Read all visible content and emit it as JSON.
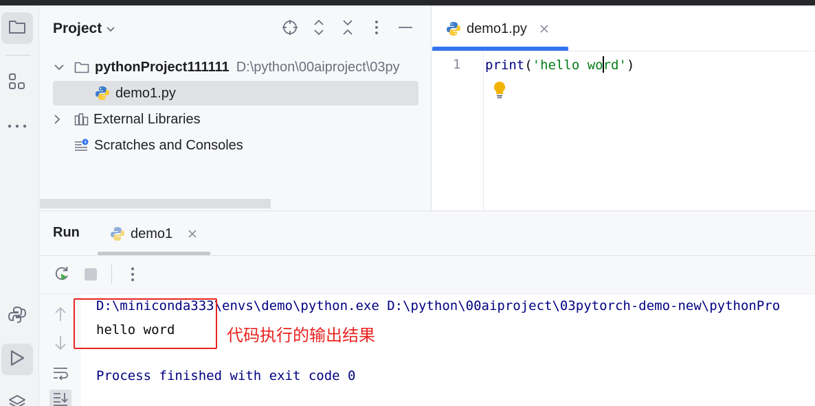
{
  "project_panel": {
    "title": "Project",
    "tree": [
      {
        "label": "pythonProject111111",
        "path": "D:\\python\\00aiproject\\03py"
      },
      {
        "label": "demo1.py"
      },
      {
        "label": "External Libraries"
      },
      {
        "label": "Scratches and Consoles"
      }
    ]
  },
  "editor": {
    "tab_label": "demo1.py",
    "line_number": "1",
    "code": {
      "fn": "print",
      "open": "(",
      "str_before_caret": "'hello wo",
      "str_after_caret": "rd'",
      "close": ")"
    }
  },
  "run_panel": {
    "title": "Run",
    "tab_label": "demo1",
    "console": {
      "command_line": "D:\\miniconda333\\envs\\demo\\python.exe D:\\python\\00aiproject\\03pytorch-demo-new\\pythonPro",
      "output": "hello word",
      "exit_line": "Process finished with exit code 0"
    },
    "annotation": "代码执行的输出结果"
  },
  "colors": {
    "accent": "#3574f0",
    "annotation": "#e8231f",
    "keyword_fn": "#000080",
    "string": "#067d17"
  }
}
